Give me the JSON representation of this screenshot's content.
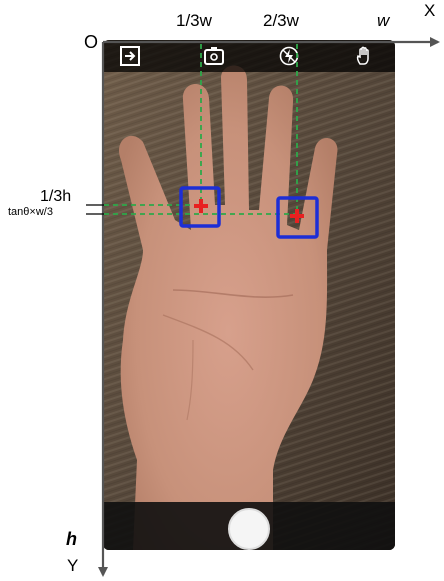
{
  "axes": {
    "origin": "O",
    "x_axis": "X",
    "y_axis": "Y",
    "width": "w",
    "height": "h"
  },
  "marks": {
    "x_one_third": "1/3w",
    "x_two_thirds": "2/3w",
    "y_one_third": "1/3h",
    "y_offset": "tanθ×w/3"
  },
  "toolbar": {
    "icons": [
      "exit-icon",
      "camera-switch-icon",
      "flash-off-icon",
      "hand-icon"
    ]
  },
  "colors": {
    "guide_line": "#2ea84a",
    "marker_box": "#1d2ed6",
    "marker_cross": "#e82020",
    "axis": "#555555"
  }
}
